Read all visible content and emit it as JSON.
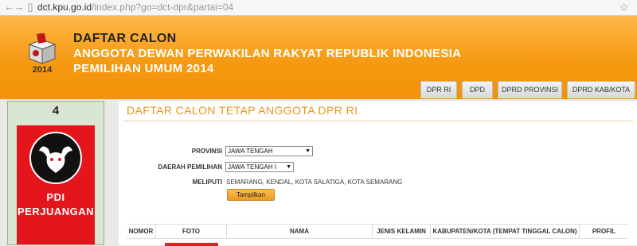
{
  "browser": {
    "url_domain": "dct.kpu.go.id",
    "url_path": "/index.php?go=dct-dpr&partai=04"
  },
  "header": {
    "logo_year": "2014",
    "title1": "DAFTAR CALON",
    "title2": "ANGGOTA DEWAN PERWAKILAN RAKYAT REPUBLIK INDONESIA",
    "title3": "PEMILIHAN UMUM 2014",
    "tabs": [
      "DPR RI",
      "DPD",
      "DPRD PROVINSI",
      "DPRD KAB/KOTA"
    ]
  },
  "sidebar": {
    "party_number": "4",
    "party_name_line1": "PDI",
    "party_name_line2": "PERJUANGAN"
  },
  "main": {
    "section_title": "DAFTAR CALON TETAP ANGGOTA DPR RI",
    "form": {
      "provinsi_label": "PROVINSI",
      "provinsi_value": "JAWA TENGAH",
      "dapil_label": "DAERAH PEMILIHAN",
      "dapil_value": "JAWA TENGAH I",
      "meliputi_label": "MELIPUTI",
      "meliputi_value": "SEMARANG, KENDAL, KOTA SALATIGA, KOTA SEMARANG",
      "button_label": "Tampilkan"
    },
    "table_headers": [
      "NOMOR",
      "FOTO",
      "NAMA",
      "JENIS KELAMIN",
      "KABUPATEN/KOTA (TEMPAT TINGGAL CALON)",
      "PROFIL"
    ]
  },
  "colors": {
    "header_orange": "#f59a12",
    "section_title": "#e8961c",
    "party_red": "#e4161b"
  }
}
